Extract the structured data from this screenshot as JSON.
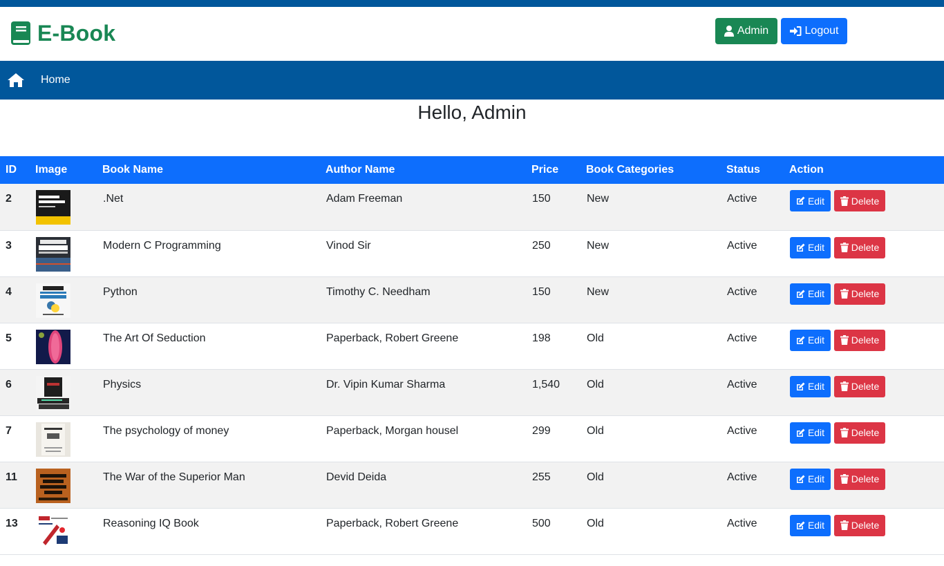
{
  "header": {
    "brand": "E-Book",
    "admin_label": "Admin",
    "logout_label": "Logout"
  },
  "nav": {
    "home_label": "Home"
  },
  "greeting": "Hello, Admin",
  "table": {
    "columns": [
      "ID",
      "Image",
      "Book Name",
      "Author Name",
      "Price",
      "Book Categories",
      "Status",
      "Action"
    ],
    "edit_label": "Edit",
    "delete_label": "Delete",
    "rows": [
      {
        "id": "2",
        "cover_icon": "aspnet-core-book-cover",
        "book": ".Net",
        "author": "Adam Freeman",
        "price": "150",
        "category": "New",
        "status": "Active"
      },
      {
        "id": "3",
        "cover_icon": "modern-c-book-cover",
        "book": "Modern C Programming",
        "author": "Vinod Sir",
        "price": "250",
        "category": "New",
        "status": "Active"
      },
      {
        "id": "4",
        "cover_icon": "python-book-cover",
        "book": "Python",
        "author": "Timothy C. Needham",
        "price": "150",
        "category": "New",
        "status": "Active"
      },
      {
        "id": "5",
        "cover_icon": "art-of-seduction-book-cover",
        "book": "The Art Of Seduction",
        "author": "Paperback, Robert Greene",
        "price": "198",
        "category": "Old",
        "status": "Active"
      },
      {
        "id": "6",
        "cover_icon": "physics-book-cover",
        "book": "Physics",
        "author": "Dr. Vipin Kumar Sharma",
        "price": "1,540",
        "category": "Old",
        "status": "Active"
      },
      {
        "id": "7",
        "cover_icon": "psychology-of-money-book-cover",
        "book": "The psychology of money",
        "author": "Paperback, Morgan housel",
        "price": "299",
        "category": "Old",
        "status": "Active"
      },
      {
        "id": "11",
        "cover_icon": "superior-man-book-cover",
        "book": "The War of the Superior Man",
        "author": "Devid Deida",
        "price": "255",
        "category": "Old",
        "status": "Active"
      },
      {
        "id": "13",
        "cover_icon": "reasoning-iq-book-cover",
        "book": "Reasoning IQ Book",
        "author": "Paperback, Robert Greene",
        "price": "500",
        "category": "Old",
        "status": "Active"
      }
    ]
  },
  "colors": {
    "navbar": "#01579b",
    "brand_green": "#198754",
    "primary_blue": "#0d6efd",
    "danger_red": "#dc3545"
  }
}
